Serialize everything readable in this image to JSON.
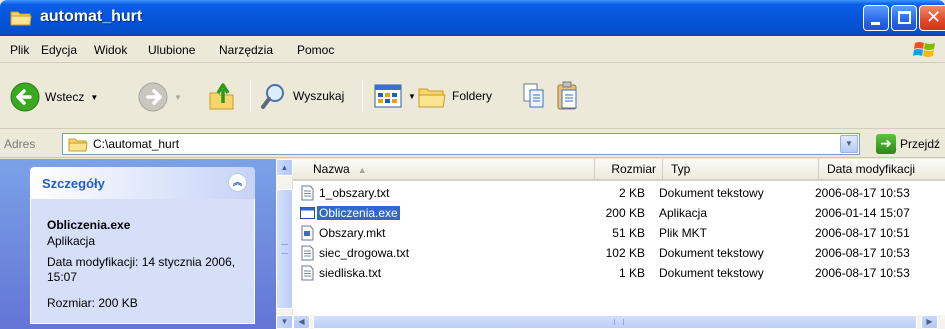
{
  "window": {
    "title": "automat_hurt"
  },
  "menu": [
    "Plik",
    "Edycja",
    "Widok",
    "Ulubione",
    "Narzędzia",
    "Pomoc"
  ],
  "toolbar": {
    "back_label": "Wstecz",
    "search_label": "Wyszukaj",
    "folders_label": "Foldery"
  },
  "address": {
    "label": "Adres",
    "path": "C:\\automat_hurt",
    "go_label": "Przejdź"
  },
  "details": {
    "title": "Szczegóły",
    "name": "Obliczenia.exe",
    "type": "Aplikacja",
    "modified": "Data modyfikacji: 14 stycznia 2006, 15:07",
    "size": "Rozmiar: 200 KB"
  },
  "columns": {
    "name": "Nazwa",
    "size": "Rozmiar",
    "type": "Typ",
    "date": "Data modyfikacji"
  },
  "files": [
    {
      "name": "1_obszary.txt",
      "size": "2 KB",
      "type": "Dokument tekstowy",
      "date": "2006-08-17 10:53",
      "icon": "text-file-icon"
    },
    {
      "name": "Obliczenia.exe",
      "size": "200 KB",
      "type": "Aplikacja",
      "date": "2006-01-14 15:07",
      "icon": "exe-file-icon",
      "selected": true
    },
    {
      "name": "Obszary.mkt",
      "size": "51 KB",
      "type": "Plik MKT",
      "date": "2006-08-17 10:51",
      "icon": "mkt-file-icon"
    },
    {
      "name": "siec_drogowa.txt",
      "size": "102 KB",
      "type": "Dokument tekstowy",
      "date": "2006-08-17 10:53",
      "icon": "text-file-icon"
    },
    {
      "name": "siedliska.txt",
      "size": "1 KB",
      "type": "Dokument tekstowy",
      "date": "2006-08-17 10:53",
      "icon": "text-file-icon"
    }
  ]
}
